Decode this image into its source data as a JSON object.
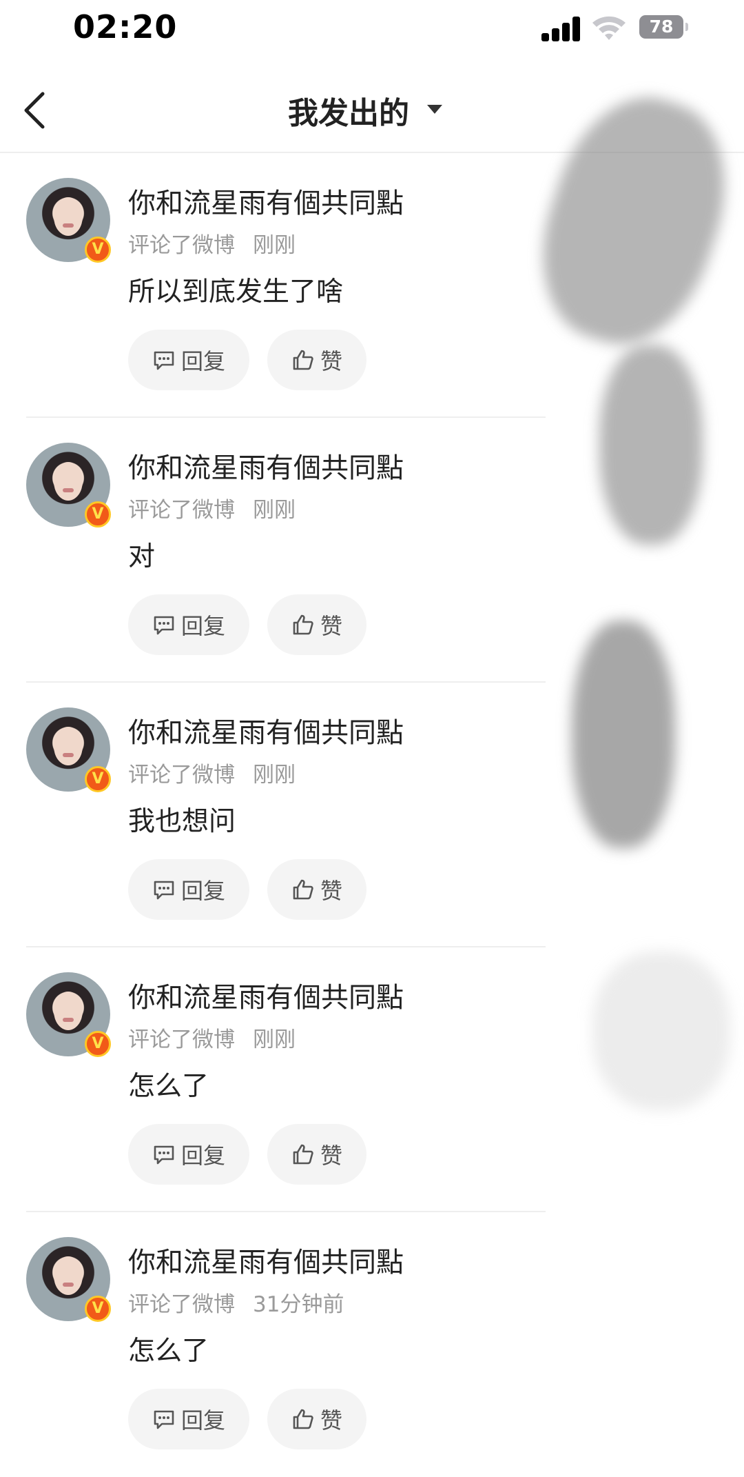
{
  "status_bar": {
    "time": "02:20",
    "battery": "78"
  },
  "nav": {
    "title": "我发出的"
  },
  "comments": [
    {
      "username": "你和流星雨有個共同點",
      "action": "评论了微博",
      "time": "刚刚",
      "text": "所以到底发生了啥",
      "reply_label": "回复",
      "like_label": "赞",
      "badge": "V"
    },
    {
      "username": "你和流星雨有個共同點",
      "action": "评论了微博",
      "time": "刚刚",
      "text": "对",
      "reply_label": "回复",
      "like_label": "赞",
      "badge": "V"
    },
    {
      "username": "你和流星雨有個共同點",
      "action": "评论了微博",
      "time": "刚刚",
      "text": "我也想问",
      "reply_label": "回复",
      "like_label": "赞",
      "badge": "V"
    },
    {
      "username": "你和流星雨有個共同點",
      "action": "评论了微博",
      "time": "刚刚",
      "text": "怎么了",
      "reply_label": "回复",
      "like_label": "赞",
      "badge": "V"
    },
    {
      "username": "你和流星雨有個共同點",
      "action": "评论了微博",
      "time": "31分钟前",
      "text": "怎么了",
      "reply_label": "回复",
      "like_label": "赞",
      "badge": "V"
    }
  ],
  "colors": {
    "badge": "#f15a18",
    "badge_border": "#ffc825",
    "meta": "#9a9a9a",
    "button_bg": "#f4f4f4"
  }
}
